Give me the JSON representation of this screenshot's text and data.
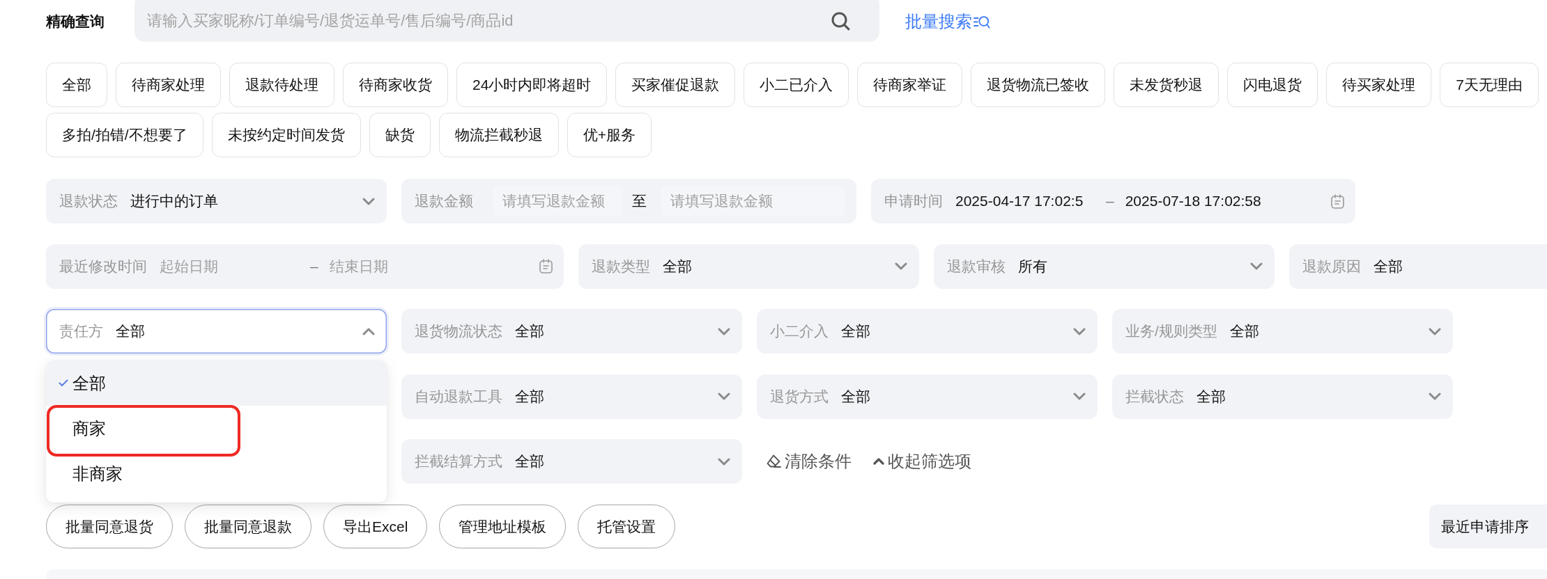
{
  "search_bar": {
    "label": "精确查询",
    "placeholder": "请输入买家昵称/订单编号/退货运单号/售后编号/商品id",
    "batch_search": "批量搜索"
  },
  "quick_filters": [
    {
      "label": "全部",
      "selected": false
    },
    {
      "label": "待商家处理",
      "selected": false
    },
    {
      "label": "退款待处理",
      "selected": false
    },
    {
      "label": "待商家收货",
      "selected": false
    },
    {
      "label": "24小时内即将超时",
      "selected": false
    },
    {
      "label": "买家催促退款",
      "selected": false
    },
    {
      "label": "小二已介入",
      "selected": false
    },
    {
      "label": "待商家举证",
      "selected": false
    },
    {
      "label": "退货物流已签收",
      "selected": false
    },
    {
      "label": "未发货秒退",
      "selected": false
    },
    {
      "label": "闪电退货",
      "selected": false
    },
    {
      "label": "待买家处理",
      "selected": false
    },
    {
      "label": "7天无理由",
      "selected": false
    },
    {
      "label": "多拍/拍错/不想要了",
      "selected": false
    },
    {
      "label": "未按约定时间发货",
      "selected": false
    },
    {
      "label": "缺货",
      "selected": false
    },
    {
      "label": "物流拦截秒退",
      "selected": false
    },
    {
      "label": "优+服务",
      "selected": false
    }
  ],
  "filter_rows": [
    {
      "fields": [
        {
          "kind": "select",
          "label": "退款状态",
          "value": "进行中的订单",
          "expanded": false
        },
        {
          "kind": "amount_range",
          "label": "退款金额",
          "start": {
            "placeholder": "请填写退款金额"
          },
          "separator": "至",
          "end": {
            "placeholder": "请填写退款金额"
          }
        },
        {
          "kind": "date_range",
          "label": "申请时间",
          "start": {
            "value": "2025-04-17 17:02:5"
          },
          "separator": "–",
          "end": {
            "value": "2025-07-18 17:02:58"
          }
        }
      ]
    },
    {
      "fields": [
        {
          "kind": "date_range",
          "label": "最近修改时间",
          "start": {
            "placeholder": "起始日期"
          },
          "separator": "–",
          "end": {
            "placeholder": "结束日期"
          }
        },
        {
          "kind": "select",
          "label": "退款类型",
          "value": "全部",
          "expanded": false
        },
        {
          "kind": "select",
          "label": "退款审核",
          "value": "所有",
          "expanded": false
        },
        {
          "kind": "select",
          "label": "退款原因",
          "value": "全部",
          "expanded": false
        }
      ]
    },
    {
      "fields": [
        {
          "kind": "select",
          "label": "责任方",
          "value": "全部",
          "expanded": true,
          "options": [
            {
              "label": "全部",
              "selected": true,
              "highlighted": false
            },
            {
              "label": "商家",
              "selected": false,
              "highlighted": true
            },
            {
              "label": "非商家",
              "selected": false,
              "highlighted": false
            }
          ]
        },
        {
          "kind": "select",
          "label": "退货物流状态",
          "value": "全部",
          "expanded": false
        },
        {
          "kind": "select",
          "label": "小二介入",
          "value": "全部",
          "expanded": false
        },
        {
          "kind": "select",
          "label": "业务/规则类型",
          "value": "全部",
          "expanded": false
        }
      ]
    },
    {
      "fields": [
        {
          "kind": "select",
          "label": "自动退款工具",
          "value": "全部",
          "expanded": false
        },
        {
          "kind": "select",
          "label": "退货方式",
          "value": "全部",
          "expanded": false
        },
        {
          "kind": "select",
          "label": "拦截状态",
          "value": "全部",
          "expanded": false
        }
      ]
    },
    {
      "fields": [
        {
          "kind": "select",
          "label": "拦截结算方式",
          "value": "全部",
          "expanded": false
        }
      ]
    }
  ],
  "filter_actions": [
    {
      "kind": "clear",
      "label": "清除条件"
    },
    {
      "kind": "collapse",
      "label": "收起筛选项"
    }
  ],
  "action_buttons": [
    "批量同意退货",
    "批量同意退款",
    "导出Excel",
    "管理地址模板",
    "托管设置"
  ],
  "sort_button": {
    "label": "最近申请排序"
  }
}
